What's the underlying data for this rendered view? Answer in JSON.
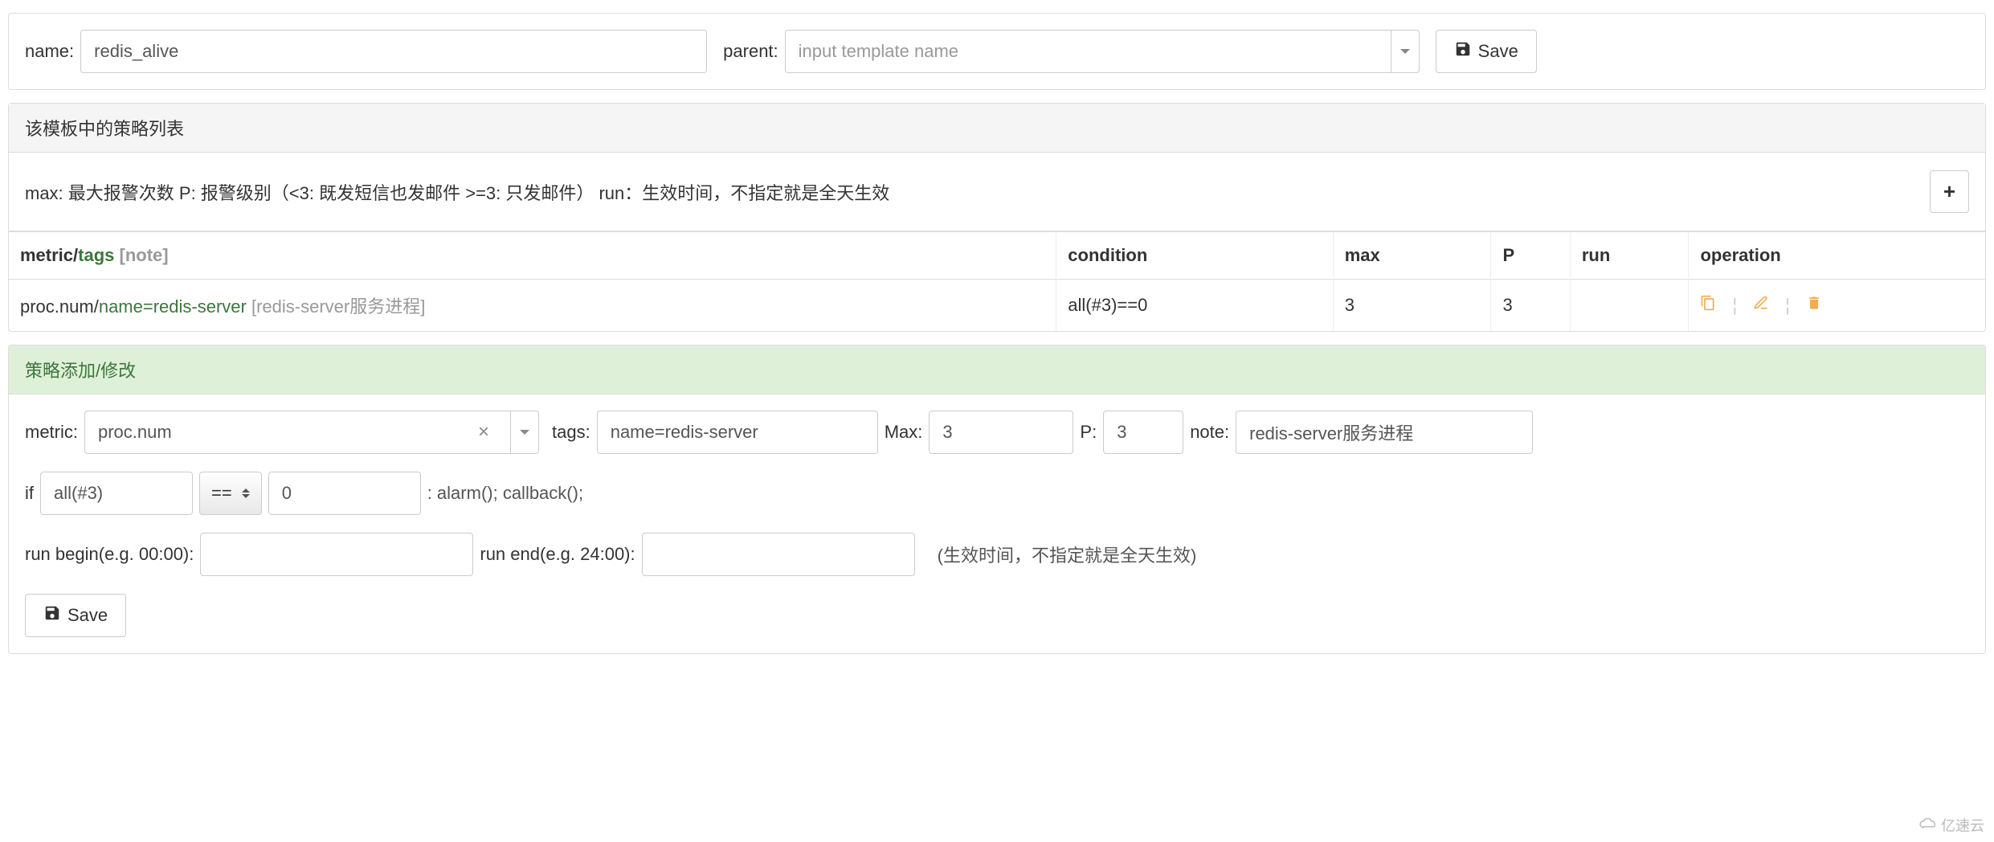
{
  "top": {
    "name_label": "name:",
    "name_value": "redis_alive",
    "parent_label": "parent:",
    "parent_placeholder": "input template name",
    "save_label": "Save"
  },
  "strategy_list": {
    "heading": "该模板中的策略列表",
    "info_text": "max: 最大报警次数 P: 报警级别（<3: 既发短信也发邮件 >=3: 只发邮件）   run：生效时间，不指定就是全天生效",
    "headers": {
      "metric": "metric/",
      "tags": "tags",
      "note_suffix": " [note]",
      "condition": "condition",
      "max": "max",
      "p": "P",
      "run": "run",
      "operation": "operation"
    },
    "rows": [
      {
        "metric": "proc.num/",
        "tags": "name=redis-server",
        "note": " [redis-server服务进程]",
        "condition": "all(#3)==0",
        "max": "3",
        "p": "3",
        "run": ""
      }
    ]
  },
  "strategy_form": {
    "heading": "策略添加/修改",
    "metric_label": "metric:",
    "metric_value": "proc.num",
    "tags_label": "tags:",
    "tags_value": "name=redis-server",
    "max_label": "Max:",
    "max_value": "3",
    "p_label": "P:",
    "p_value": "3",
    "note_label": "note:",
    "note_value": "redis-server服务进程",
    "if_label": "if",
    "func_value": "all(#3)",
    "op_value": "==",
    "threshold_value": "0",
    "after_text": ": alarm(); callback();",
    "run_begin_label": "run begin(e.g. 00:00):",
    "run_begin_value": "",
    "run_end_label": "run end(e.g. 24:00):",
    "run_end_value": "",
    "time_hint": "(生效时间，不指定就是全天生效)",
    "save_label": "Save"
  },
  "watermark": "亿速云"
}
